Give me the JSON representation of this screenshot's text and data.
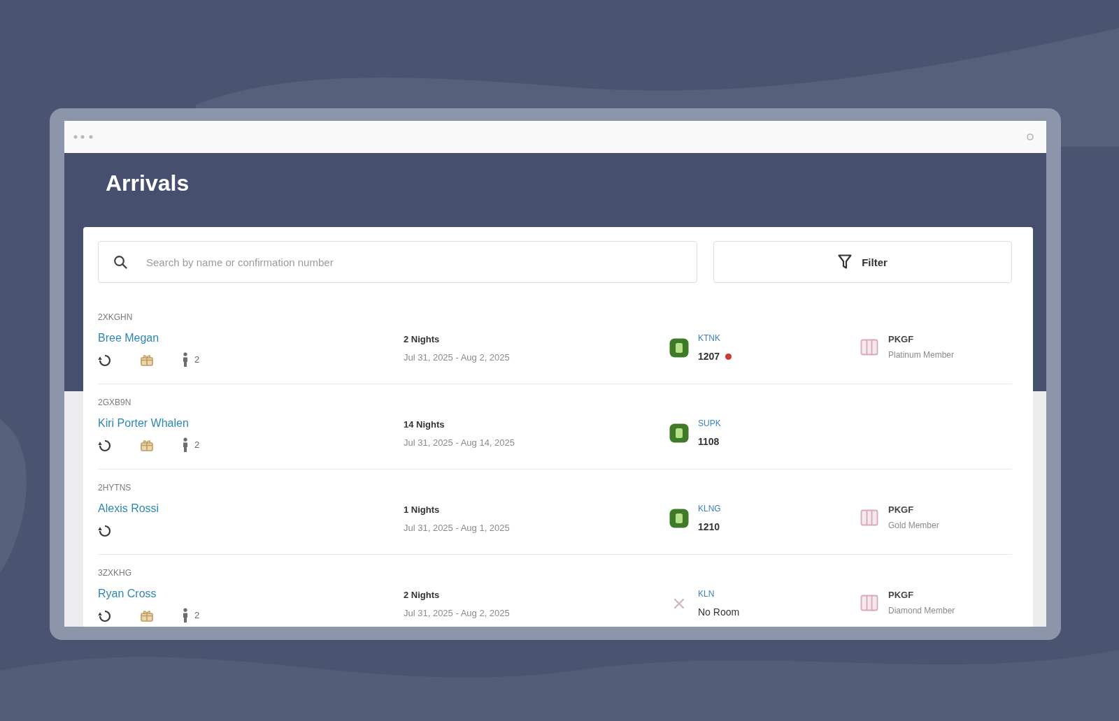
{
  "page": {
    "title": "Arrivals"
  },
  "search": {
    "placeholder": "Search by name or confirmation number"
  },
  "filter_button": {
    "label": "Filter"
  },
  "arrivals": [
    {
      "confirmation": "2XKGHN",
      "guest": "Bree Megan",
      "badges": [
        {
          "kind": "clock"
        },
        {
          "kind": "gift"
        },
        {
          "kind": "guests",
          "count": "2"
        }
      ],
      "nights": "2 Nights",
      "dates": "Jul 31, 2025 - Aug 2, 2025",
      "room": {
        "kind": "assigned",
        "type": "KTNK",
        "value": "1207",
        "alert": true
      },
      "membership": {
        "package": "PKGF",
        "tier": "Platinum Member"
      }
    },
    {
      "confirmation": "2GXB9N",
      "guest": "Kiri Porter Whalen",
      "badges": [
        {
          "kind": "clock"
        },
        {
          "kind": "gift"
        },
        {
          "kind": "guests",
          "count": "2"
        }
      ],
      "nights": "14 Nights",
      "dates": "Jul 31, 2025 - Aug 14, 2025",
      "room": {
        "kind": "assigned",
        "type": "SUPK",
        "value": "1108",
        "alert": false
      }
    },
    {
      "confirmation": "2HYTNS",
      "guest": "Alexis Rossi",
      "badges": [
        {
          "kind": "clock"
        }
      ],
      "nights": "1 Nights",
      "dates": "Jul 31, 2025 - Aug 1, 2025",
      "room": {
        "kind": "assigned",
        "type": "KLNG",
        "value": "1210",
        "alert": false
      },
      "membership": {
        "package": "PKGF",
        "tier": "Gold Member"
      }
    },
    {
      "confirmation": "3ZXKHG",
      "guest": "Ryan Cross",
      "badges": [
        {
          "kind": "clock"
        },
        {
          "kind": "gift"
        },
        {
          "kind": "guests",
          "count": "2"
        }
      ],
      "nights": "2 Nights",
      "dates": "Jul 31, 2025 - Aug 2, 2025",
      "room": {
        "kind": "none",
        "type": "KLN",
        "value": "No Room",
        "alert": false
      },
      "membership": {
        "package": "PKGF",
        "tier": "Diamond Member"
      }
    }
  ]
}
